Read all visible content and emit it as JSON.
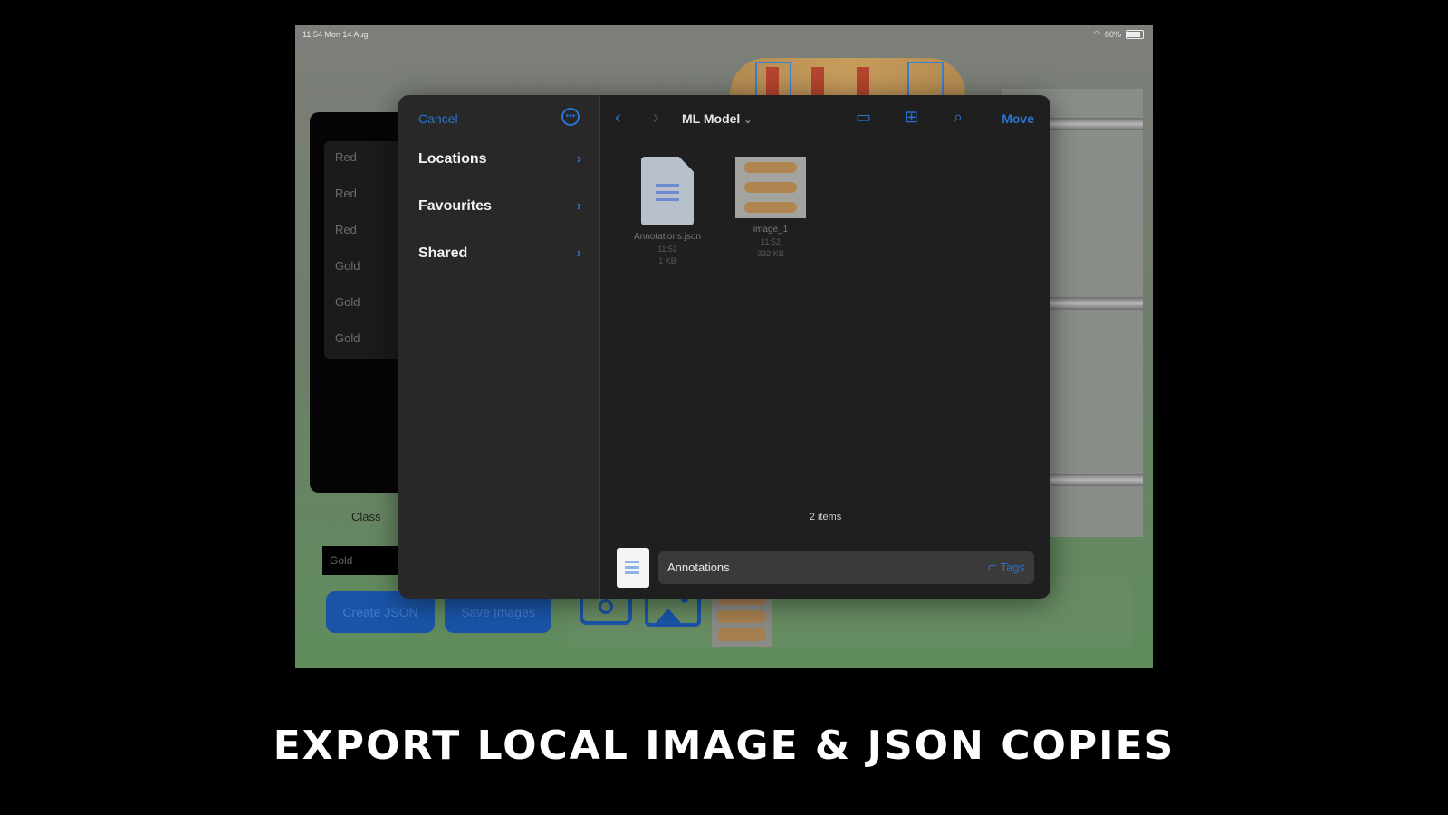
{
  "status_bar": {
    "time_date": "11:54 Mon 14 Aug",
    "battery": "80%"
  },
  "app": {
    "class_list": [
      "Red",
      "Red",
      "Red",
      "Gold",
      "Gold",
      "Gold"
    ],
    "class_label": "Class",
    "class_field_value": "Gold",
    "create_json_label": "Create JSON",
    "save_images_label": "Save Images"
  },
  "dialog": {
    "cancel_label": "Cancel",
    "sidebar_items": [
      "Locations",
      "Favourites",
      "Shared"
    ],
    "folder_title": "ML Model",
    "move_label": "Move",
    "files": [
      {
        "name": "Annotations.json",
        "line1": "11:52",
        "line2": "1 KB"
      },
      {
        "name": "image_1",
        "line1": "11:52",
        "line2": "332 KB"
      }
    ],
    "item_count": "2 items",
    "save_name": "Annotations",
    "tags_label": "Tags"
  },
  "caption": "EXPORT LOCAL IMAGE & JSON COPIES",
  "colors": {
    "accent": "#2a71d0",
    "background": "#000000",
    "app_green": "#5f8d5c"
  }
}
